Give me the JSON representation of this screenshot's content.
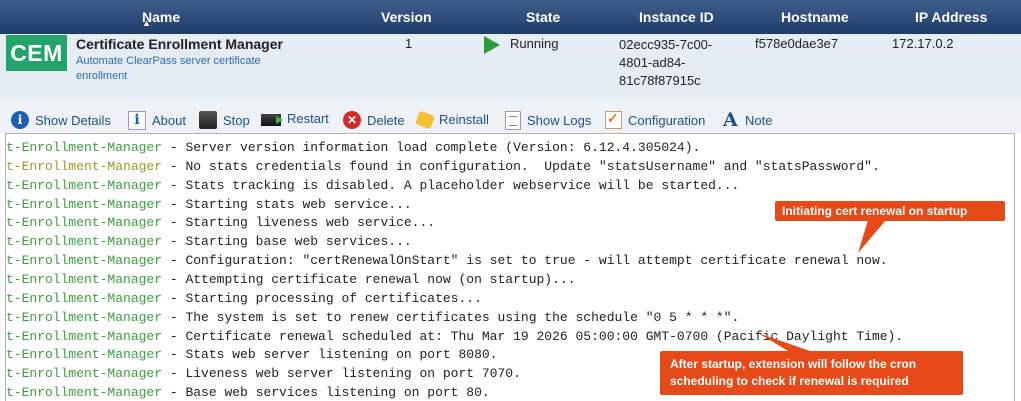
{
  "header": {
    "sort_icon": "▲",
    "name": "Name",
    "version": "Version",
    "state": "State",
    "instance_id": "Instance ID",
    "hostname": "Hostname",
    "ip": "IP Address"
  },
  "instance": {
    "logo": "CEM",
    "name": "Certificate Enrollment Manager",
    "desc_line1": "Automate ClearPass server certificate",
    "desc_line2": "enrollment",
    "version": "1",
    "state": "Running",
    "id_lines": [
      "02ecc935-7c00-",
      "4801-ad84-",
      "81c78f87915c"
    ],
    "hostname": "f578e0dae3e7",
    "ip": "172.17.0.2",
    "colors": {
      "logo_bg": "#21a36a",
      "running_icon": "#2e9b3a"
    }
  },
  "toolbar": [
    {
      "label": "Show Details",
      "icon": "info-icon"
    },
    {
      "label": "About",
      "icon": "about-icon"
    },
    {
      "label": "Stop",
      "icon": "stop-icon"
    },
    {
      "label": "Restart",
      "icon": "restart-icon"
    },
    {
      "label": "Delete",
      "icon": "delete-icon"
    },
    {
      "label": "Reinstall",
      "icon": "reinstall-icon"
    },
    {
      "label": "Show Logs",
      "icon": "logs-icon"
    },
    {
      "label": "Configuration",
      "icon": "configuration-icon"
    },
    {
      "label": "Note",
      "icon": "note-icon"
    }
  ],
  "log": {
    "source": "t-Enrollment-Manager",
    "sep": " - ",
    "lines": [
      {
        "msg": "Server version information load complete (Version: 6.12.4.305024).",
        "level": "info"
      },
      {
        "msg": "No stats credentials found in configuration.  Update \"statsUsername\" and \"statsPassword\".",
        "level": "warn"
      },
      {
        "msg": "Stats tracking is disabled. A placeholder webservice will be started...",
        "level": "info"
      },
      {
        "msg": "Starting stats web service...",
        "level": "info"
      },
      {
        "msg": "Starting liveness web service...",
        "level": "info"
      },
      {
        "msg": "Starting base web services...",
        "level": "info"
      },
      {
        "msg": "Configuration: \"certRenewalOnStart\" is set to true - will attempt certificate renewal now.",
        "level": "info"
      },
      {
        "msg": "Attempting certificate renewal now (on startup)...",
        "level": "info"
      },
      {
        "msg": "Starting processing of certificates...",
        "level": "info"
      },
      {
        "msg": "The system is set to renew certificates using the schedule \"0 5 * * *\".",
        "level": "info"
      },
      {
        "msg": "Certificate renewal scheduled at: Thu Mar 19 2026 05:00:00 GMT-0700 (Pacific Daylight Time).",
        "level": "info"
      },
      {
        "msg": "Stats web server listening on port 8080.",
        "level": "info"
      },
      {
        "msg": "Liveness web server listening on port 7070.",
        "level": "info"
      },
      {
        "msg": "Base web services listening on port 80.",
        "level": "info"
      }
    ]
  },
  "callouts": {
    "renewal_on_startup": "Initiating cert renewal on startup",
    "cron_line1": "After startup, extension will follow the cron",
    "cron_line2": "scheduling to check if renewal is required",
    "color": "#e64a19"
  }
}
